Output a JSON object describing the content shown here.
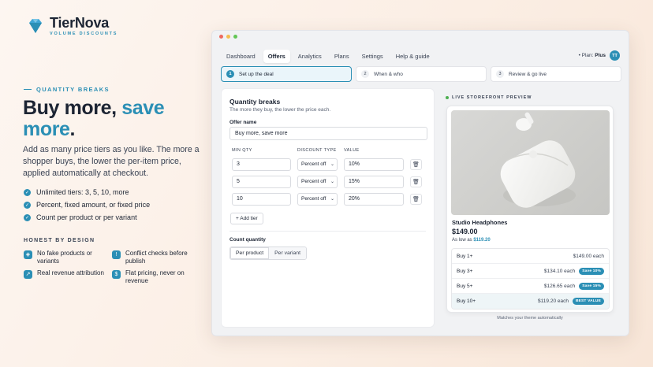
{
  "brand": {
    "name": "TierNova",
    "tagline": "VOLUME DISCOUNTS",
    "accent": "#2b8fb5"
  },
  "hero": {
    "eyebrow": "QUANTITY BREAKS",
    "headline_plain": "Buy more, ",
    "headline_accent": "save",
    "headline_accent2": "more",
    "headline_end": ".",
    "lede": "Add as many price tiers as you like. The more a shopper buys, the lower the per-item price, applied automatically at checkout.",
    "checks": [
      "Unlimited tiers: 3, 5, 10, more",
      "Percent, fixed amount, or fixed price",
      "Count per product or per variant"
    ]
  },
  "honest": {
    "title": "HONEST BY DESIGN",
    "items": [
      {
        "icon": "shield-icon",
        "text": "No fake products or variants"
      },
      {
        "icon": "alert-icon",
        "text": "Conflict checks before publish"
      },
      {
        "icon": "trend-icon",
        "text": "Real revenue attribution"
      },
      {
        "icon": "tag-icon",
        "text": "Flat pricing, never on revenue"
      }
    ]
  },
  "app": {
    "nav": [
      "Dashboard",
      "Offers",
      "Analytics",
      "Plans",
      "Settings",
      "Help & guide"
    ],
    "nav_active": "Offers",
    "plan_prefix": "• Plan: ",
    "plan_name": "Plus",
    "avatar": "TT",
    "steps": [
      {
        "num": "1",
        "label": "Set up the deal"
      },
      {
        "num": "2",
        "label": "When & who"
      },
      {
        "num": "3",
        "label": "Review & go live"
      }
    ],
    "form": {
      "title": "Quantity breaks",
      "subtitle": "The more they buy, the lower the price each.",
      "offer_name_label": "Offer name",
      "offer_name_value": "Buy more, save more",
      "headers": {
        "min_qty": "MIN QTY",
        "discount_type": "DISCOUNT TYPE",
        "value": "VALUE"
      },
      "rows": [
        {
          "min_qty": "3",
          "type": "Percent off",
          "value": "10%"
        },
        {
          "min_qty": "5",
          "type": "Percent off",
          "value": "15%"
        },
        {
          "min_qty": "10",
          "type": "Percent off",
          "value": "20%"
        }
      ],
      "add_tier": "+ Add tier",
      "count_label": "Count quantity",
      "count_options": [
        "Per product",
        "Per variant"
      ],
      "count_selected": "Per product"
    },
    "preview": {
      "label": "LIVE STOREFRONT PREVIEW",
      "product_name": "Studio Headphones",
      "price": "$149.00",
      "as_low_prefix": "As low as ",
      "as_low_value": "$119.20",
      "tiers": [
        {
          "label": "Buy 1+",
          "price": "$149.00 each",
          "badge": ""
        },
        {
          "label": "Buy 3+",
          "price": "$134.10 each",
          "badge": "Save 10%"
        },
        {
          "label": "Buy 5+",
          "price": "$126.65 each",
          "badge": "Save 15%"
        },
        {
          "label": "Buy 10+",
          "price": "$119.20 each",
          "badge": "BEST VALUE"
        }
      ],
      "footer": "Matches your theme automatically"
    }
  }
}
